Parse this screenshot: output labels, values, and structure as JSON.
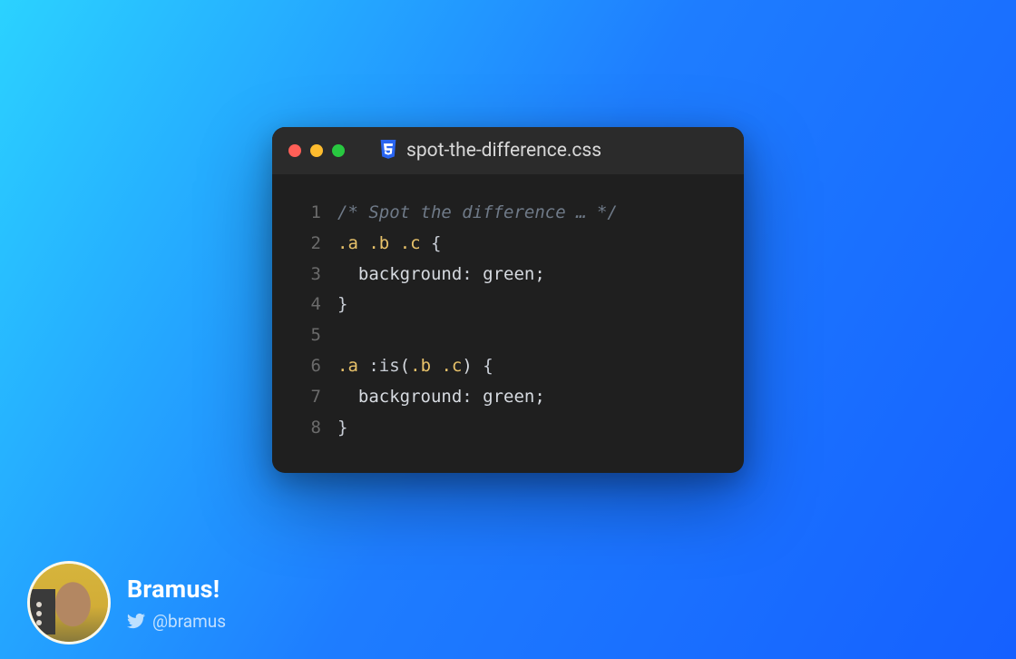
{
  "editor": {
    "filename": "spot-the-difference.css",
    "icon": "css3-icon",
    "traffic_lights": [
      "close",
      "minimize",
      "zoom"
    ],
    "lines": [
      {
        "n": "1",
        "tokens": [
          {
            "t": "/* Spot the difference … */",
            "c": "comment"
          }
        ]
      },
      {
        "n": "2",
        "tokens": [
          {
            "t": ".a",
            "c": "selclass"
          },
          {
            "t": " ",
            "c": "punc"
          },
          {
            "t": ".b",
            "c": "selclass"
          },
          {
            "t": " ",
            "c": "punc"
          },
          {
            "t": ".c",
            "c": "selclass"
          },
          {
            "t": " ",
            "c": "punc"
          },
          {
            "t": "{",
            "c": "brace"
          }
        ]
      },
      {
        "n": "3",
        "tokens": [
          {
            "t": "  ",
            "c": "punc"
          },
          {
            "t": "background",
            "c": "prop"
          },
          {
            "t": ": ",
            "c": "colon"
          },
          {
            "t": "green",
            "c": "value"
          },
          {
            "t": ";",
            "c": "punc"
          }
        ]
      },
      {
        "n": "4",
        "tokens": [
          {
            "t": "}",
            "c": "brace"
          }
        ]
      },
      {
        "n": "5",
        "tokens": [
          {
            "t": " ",
            "c": "punc"
          }
        ]
      },
      {
        "n": "6",
        "tokens": [
          {
            "t": ".a",
            "c": "selclass"
          },
          {
            "t": " ",
            "c": "punc"
          },
          {
            "t": ":is",
            "c": "func"
          },
          {
            "t": "(",
            "c": "punc"
          },
          {
            "t": ".b",
            "c": "selclass"
          },
          {
            "t": " ",
            "c": "punc"
          },
          {
            "t": ".c",
            "c": "selclass"
          },
          {
            "t": ")",
            "c": "punc"
          },
          {
            "t": " ",
            "c": "punc"
          },
          {
            "t": "{",
            "c": "brace"
          }
        ]
      },
      {
        "n": "7",
        "tokens": [
          {
            "t": "  ",
            "c": "punc"
          },
          {
            "t": "background",
            "c": "prop"
          },
          {
            "t": ": ",
            "c": "colon"
          },
          {
            "t": "green",
            "c": "value"
          },
          {
            "t": ";",
            "c": "punc"
          }
        ]
      },
      {
        "n": "8",
        "tokens": [
          {
            "t": "}",
            "c": "brace"
          }
        ]
      }
    ]
  },
  "author": {
    "name": "Bramus!",
    "handle": "@bramus",
    "platform_icon": "twitter-icon"
  }
}
